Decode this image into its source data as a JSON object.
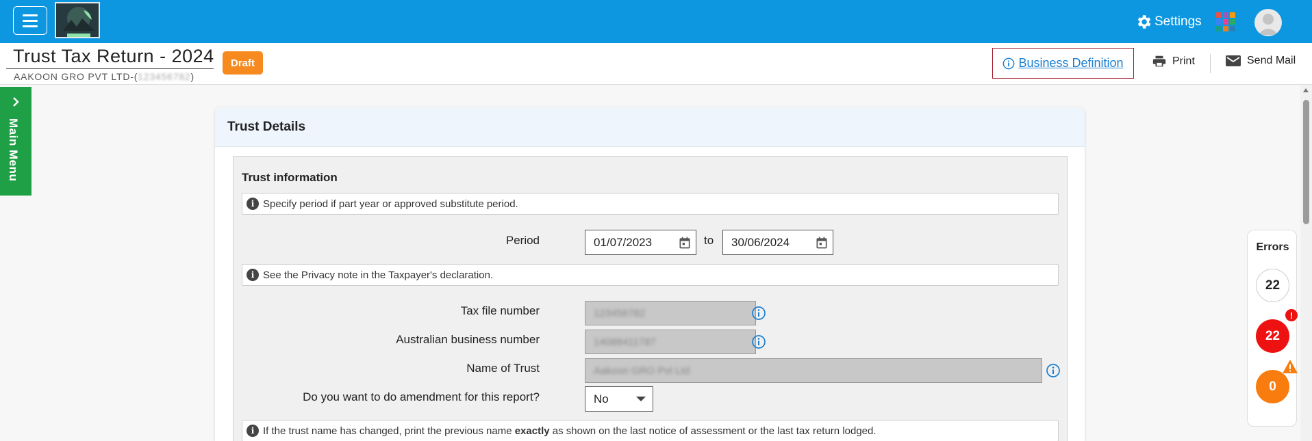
{
  "topbar": {
    "settings_label": "Settings",
    "accent_color": "#0d97e0"
  },
  "header": {
    "title": "Trust Tax Return - 2024",
    "company_name": "AAKOON GRO PVT LTD-(",
    "company_id": "123456782",
    "company_suffix": ")",
    "status_badge": "Draft",
    "business_definition_label": "Business Definition",
    "print_label": "Print",
    "send_mail_label": "Send Mail"
  },
  "sidebar": {
    "main_menu_label": "Main Menu"
  },
  "card": {
    "title": "Trust Details",
    "section_title": "Trust information",
    "notes": {
      "period": "Specify period if part year or approved substitute period.",
      "privacy": "See the Privacy note in the Taxpayer's declaration.",
      "name_change_before": "If the trust name has changed, print the previous name ",
      "name_change_bold": "exactly",
      "name_change_after": " as shown on the last notice of assessment or the last tax return lodged."
    },
    "period": {
      "label": "Period",
      "from": "01/07/2023",
      "to_label": "to",
      "to": "30/06/2024"
    },
    "tax_file_number": {
      "label": "Tax file number",
      "value": "123456782"
    },
    "abn": {
      "label": "Australian business number",
      "value": "14088411787"
    },
    "trust_name": {
      "label": "Name of Trust",
      "value": "Aakoon GRO Pvt Ltd"
    },
    "amendment": {
      "label": "Do you want to do amendment for this report?",
      "selected": "No"
    }
  },
  "errors": {
    "title": "Errors",
    "total": "22",
    "errors_count": "22",
    "warnings_count": "0",
    "error_color": "#ee1111",
    "warning_color": "#f87c0e"
  }
}
